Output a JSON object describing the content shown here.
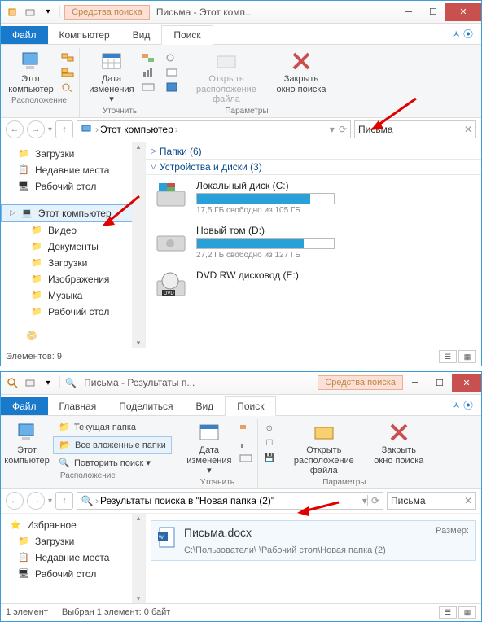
{
  "win1": {
    "qat_tooltip": "quick access",
    "search_tools": "Средства поиска",
    "title": "Письма - Этот комп...",
    "ribbon_tabs": {
      "file": "Файл",
      "computer": "Компьютер",
      "view": "Вид",
      "search": "Поиск"
    },
    "ribbon": {
      "this_pc": "Этот\nкомпьютер",
      "date_mod": "Дата\nизменения ▾",
      "open_loc": "Открыть\nрасположение файла",
      "close_search": "Закрыть\nокно поиска",
      "group_location": "Расположение",
      "group_refine": "Уточнить",
      "group_params": "Параметры"
    },
    "address": {
      "root": "Этот компьютер"
    },
    "search_value": "Письма",
    "nav": {
      "downloads": "Загрузки",
      "recent": "Недавние места",
      "desktop": "Рабочий стол",
      "this_pc": "Этот компьютер",
      "videos": "Видео",
      "documents": "Документы",
      "downloads2": "Загрузки",
      "pictures": "Изображения",
      "music": "Музыка",
      "desktop2": "Рабочий стол"
    },
    "content": {
      "folders_hdr": "Папки (6)",
      "devices_hdr": "Устройства и диски (3)",
      "drive_c": {
        "name": "Локальный диск (C:)",
        "free": "17,5 ГБ свободно из 105 ГБ",
        "pct": 83
      },
      "drive_d": {
        "name": "Новый том (D:)",
        "free": "27,2 ГБ свободно из 127 ГБ",
        "pct": 78
      },
      "dvd": {
        "name": "DVD RW дисковод (E:)"
      }
    },
    "status": "Элементов: 9"
  },
  "win2": {
    "title": "Письма - Результаты п...",
    "search_tools": "Средства поиска",
    "ribbon_tabs": {
      "file": "Файл",
      "home": "Главная",
      "share": "Поделиться",
      "view": "Вид",
      "search": "Поиск"
    },
    "ribbon": {
      "this_pc": "Этот\nкомпьютер",
      "current_folder": "Текущая папка",
      "all_subfolders": "Все вложенные папки",
      "repeat_search": "Повторить поиск ▾",
      "date_mod": "Дата\nизменения ▾",
      "open_loc": "Открыть\nрасположение файла",
      "close_search": "Закрыть\nокно поиска",
      "group_location": "Расположение",
      "group_refine": "Уточнить",
      "group_params": "Параметры"
    },
    "address": "Результаты поиска в \"Новая папка (2)\"",
    "search_value": "Письма",
    "nav": {
      "favorites": "Избранное",
      "downloads": "Загрузки",
      "recent": "Недавние места",
      "desktop": "Рабочий стол"
    },
    "result": {
      "name": "Письма.docx",
      "size_label": "Размер:",
      "path": "C:\\Пользователи\\             \\Рабочий стол\\Новая папка (2)"
    },
    "status": {
      "count": "1 элемент",
      "sel": "Выбран 1 элемент: 0 байт"
    }
  }
}
